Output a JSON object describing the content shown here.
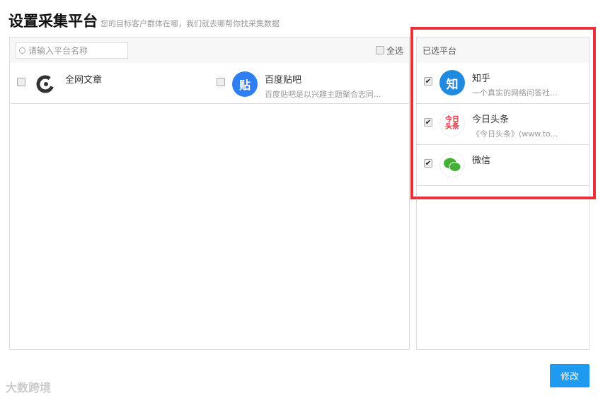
{
  "header": {
    "title": "设置采集平台",
    "subtitle": "您的目标客户群体在哪，我们就去哪帮你找采集数据"
  },
  "left": {
    "search_placeholder": "请输入平台名称",
    "select_all": "全选",
    "items": [
      {
        "name": "全网文章",
        "desc": "",
        "checked": false
      },
      {
        "name": "百度贴吧",
        "desc": "百度贴吧是以兴趣主题聚合志同...",
        "checked": false
      }
    ]
  },
  "right": {
    "title": "已选平台",
    "items": [
      {
        "name": "知乎",
        "desc": "一个真实的网络问答社...",
        "checked": true,
        "logo": "知"
      },
      {
        "name": "今日头条",
        "desc": "《今日头条》(www.to...",
        "checked": true,
        "logo": "今日头条"
      },
      {
        "name": "微信",
        "desc": "",
        "checked": true
      }
    ]
  },
  "footer": {
    "modify_label": "修改",
    "watermark": "大数跨境"
  },
  "colors": {
    "accent": "#1e9af0",
    "highlight": "#e8313a"
  }
}
